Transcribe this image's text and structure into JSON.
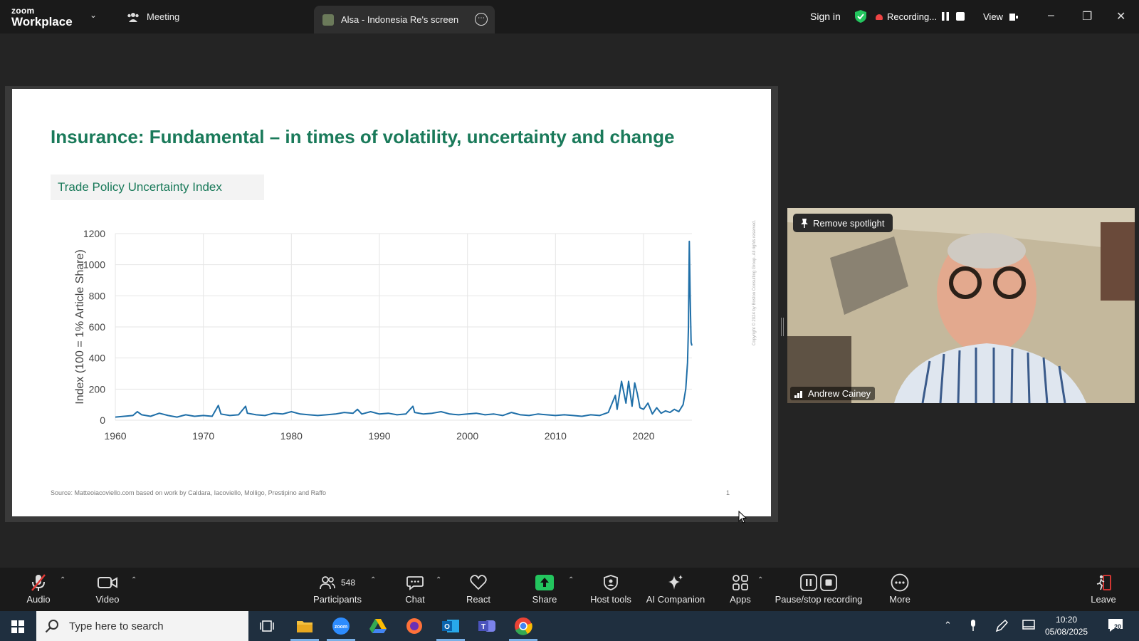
{
  "app": {
    "brand_small": "zoom",
    "brand_name": "Workplace"
  },
  "tabs": {
    "meeting": "Meeting",
    "screen": "Alsa - Indonesia Re's screen"
  },
  "header": {
    "sign_in": "Sign in",
    "recording": "Recording...",
    "view": "View"
  },
  "slide": {
    "title": "Insurance: Fundamental – in times of volatility, uncertainty and change",
    "subtitle": "Trade Policy Uncertainty Index",
    "source": "Source: Matteoiacoviello.com based on work by Caldara, Iacoviello, Molligo, Prestipino and Raffo",
    "page": "1",
    "copyright": "Copyright © 2024 by Boston Consulting Group. All rights reserved."
  },
  "chart_data": {
    "type": "line",
    "title": "Trade Policy Uncertainty Index",
    "xlabel": "",
    "ylabel": "Index (100 = 1% Article Share)",
    "xlim": [
      1960,
      2025.5
    ],
    "ylim": [
      0,
      1200
    ],
    "x_ticks": [
      "1960",
      "1970",
      "1980",
      "1990",
      "2000",
      "2010",
      "2020"
    ],
    "y_ticks": [
      "0",
      "200",
      "400",
      "600",
      "800",
      "1000",
      "1200"
    ],
    "grid": true,
    "series": [
      {
        "color": "#1f6fa8",
        "x": [
          1960,
          1961,
          1962,
          1962.5,
          1963,
          1964,
          1965,
          1966,
          1967,
          1968,
          1969,
          1970,
          1971,
          1971.7,
          1972,
          1973,
          1974,
          1974.8,
          1975,
          1976,
          1977,
          1978,
          1979,
          1980,
          1981,
          1982,
          1983,
          1984,
          1985,
          1986,
          1987,
          1987.5,
          1988,
          1989,
          1990,
          1991,
          1992,
          1993,
          1993.8,
          1994,
          1995,
          1996,
          1997,
          1998,
          1999,
          2000,
          2001,
          2002,
          2003,
          2004,
          2005,
          2006,
          2007,
          2008,
          2009,
          2010,
          2011,
          2012,
          2013,
          2014,
          2015,
          2016,
          2016.8,
          2017,
          2017.5,
          2018,
          2018.3,
          2018.7,
          2019,
          2019.3,
          2019.6,
          2020,
          2020.5,
          2021,
          2021.5,
          2022,
          2022.5,
          2023,
          2023.5,
          2024,
          2024.5,
          2024.8,
          2025,
          2025.1,
          2025.2,
          2025.3,
          2025.4,
          2025.5
        ],
        "y": [
          20,
          25,
          30,
          55,
          35,
          25,
          45,
          30,
          20,
          35,
          25,
          30,
          25,
          95,
          40,
          30,
          35,
          90,
          45,
          35,
          30,
          45,
          40,
          55,
          40,
          35,
          30,
          35,
          40,
          50,
          45,
          70,
          40,
          55,
          40,
          45,
          35,
          40,
          90,
          50,
          40,
          45,
          55,
          40,
          35,
          40,
          45,
          35,
          40,
          30,
          50,
          35,
          30,
          40,
          35,
          30,
          35,
          30,
          25,
          35,
          30,
          50,
          160,
          70,
          250,
          110,
          250,
          90,
          240,
          170,
          80,
          70,
          110,
          40,
          80,
          45,
          60,
          50,
          70,
          55,
          100,
          200,
          370,
          600,
          1150,
          800,
          500,
          480
        ]
      }
    ]
  },
  "participant_video": {
    "spotlight_label": "Remove spotlight",
    "name": "Andrew Cainey"
  },
  "toolbar": {
    "audio": "Audio",
    "video": "Video",
    "participants": "Participants",
    "participants_count": "548",
    "chat": "Chat",
    "react": "React",
    "share": "Share",
    "host_tools": "Host tools",
    "ai_companion": "AI Companion",
    "apps": "Apps",
    "pause_stop": "Pause/stop recording",
    "more": "More",
    "leave": "Leave"
  },
  "taskbar": {
    "search_placeholder": "Type here to search",
    "time": "10:20",
    "date": "05/08/2025",
    "notifications": "20"
  },
  "colors": {
    "accent": "#1a7a5a",
    "share_green": "#23c55e",
    "recording_red": "#e44"
  }
}
